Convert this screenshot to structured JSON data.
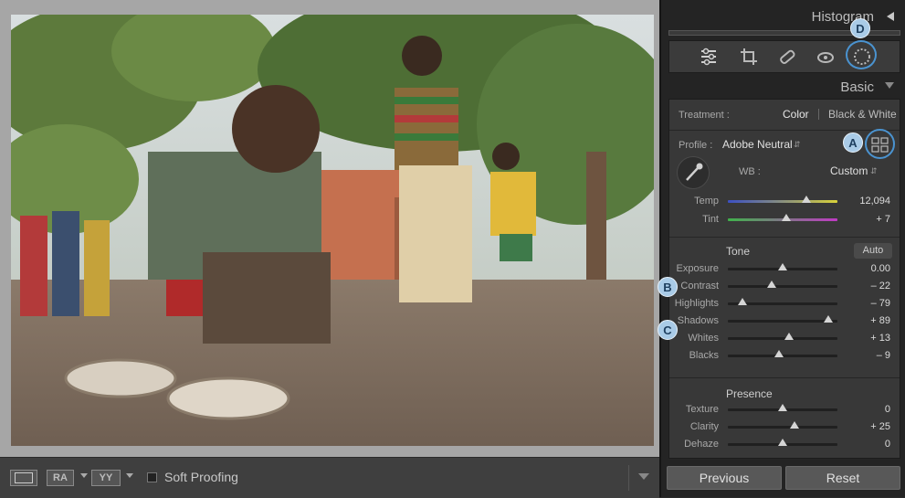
{
  "bottom_bar": {
    "btn_ra": "RA",
    "btn_yy": "YY",
    "soft_proofing": "Soft Proofing"
  },
  "right_panel": {
    "histogram_title": "Histogram",
    "basic_title": "Basic",
    "treatment_label": "Treatment :",
    "treatment_color": "Color",
    "treatment_bw": "Black & White",
    "profile_label": "Profile :",
    "profile_value": "Adobe Neutral",
    "wb_label": "WB :",
    "wb_value": "Custom",
    "tone_label": "Tone",
    "auto_label": "Auto",
    "presence_label": "Presence",
    "previous_label": "Previous",
    "reset_label": "Reset"
  },
  "wb_sliders": [
    {
      "label": "Temp",
      "value": "12,094",
      "position": 0.72
    },
    {
      "label": "Tint",
      "value": "+ 7",
      "position": 0.53
    }
  ],
  "tone_sliders": [
    {
      "label": "Exposure",
      "value": "0.00",
      "position": 0.5
    },
    {
      "label": "Contrast",
      "value": "– 22",
      "position": 0.4
    },
    {
      "label": "Highlights",
      "value": "– 79",
      "position": 0.13
    },
    {
      "label": "Shadows",
      "value": "+ 89",
      "position": 0.92
    },
    {
      "label": "Whites",
      "value": "+ 13",
      "position": 0.56
    },
    {
      "label": "Blacks",
      "value": "– 9",
      "position": 0.47
    }
  ],
  "presence_sliders": [
    {
      "label": "Texture",
      "value": "0",
      "position": 0.5
    },
    {
      "label": "Clarity",
      "value": "+ 25",
      "position": 0.61
    },
    {
      "label": "Dehaze",
      "value": "0",
      "position": 0.5
    }
  ],
  "callouts": {
    "a": "A",
    "b": "B",
    "c": "C",
    "d": "D"
  },
  "colors": {
    "callout_fill": "#a9cbe7",
    "callout_ring": "#4a93d0",
    "temp_gradient": [
      "#3b4fc4",
      "#d8d23a"
    ],
    "tint_gradient": [
      "#3fb24a",
      "#c03ac4"
    ]
  }
}
